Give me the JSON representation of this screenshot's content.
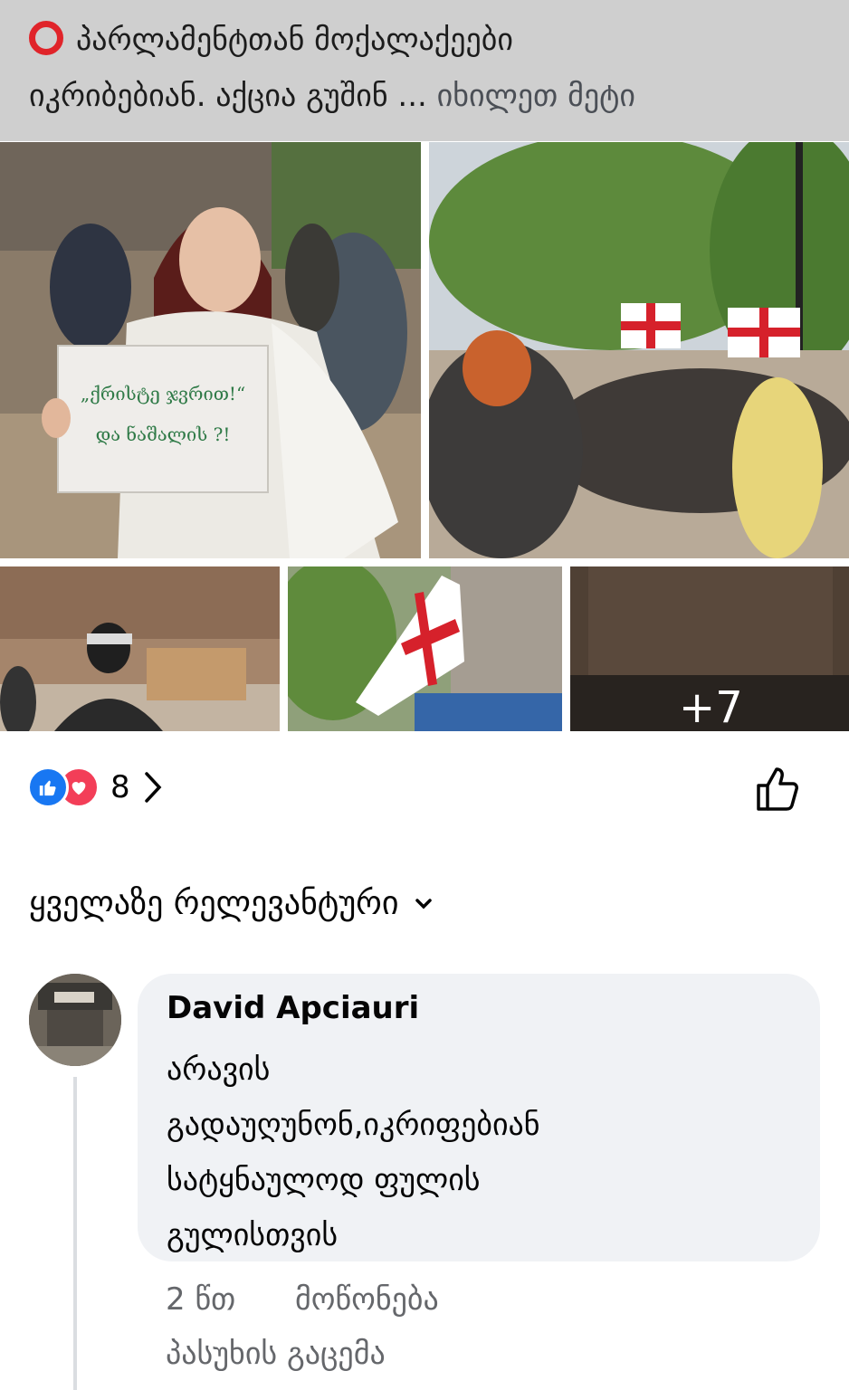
{
  "post": {
    "caption_line1": "პარლამენტთან მოქალაქეები",
    "caption_line2": "იკრიბებიან. აქცია გუშინ ...",
    "see_more": "იხილეთ მეტი",
    "caption_icon": "red-circle-icon"
  },
  "photos": {
    "sign_text_1": "„ქრისტე ჯვრით!“",
    "sign_text_2": "და ნაშალის ?!",
    "more_count": "+7"
  },
  "reactions": {
    "icons": [
      "like-icon",
      "love-icon"
    ],
    "count": "8",
    "like_color": "#1877f2",
    "love_color": "#f33e58"
  },
  "sort": {
    "label": "ყველაზე რელევანტური"
  },
  "comment": {
    "author": "David Apciauri",
    "text": "არავის\nგადაუღუნონ,იკრიფებიან\nსატყნაულოდ ფულის\nგულისთვის",
    "time": "2 წთ",
    "like_action": "მოწონება",
    "reply_action": "პასუხის გაცემა"
  }
}
